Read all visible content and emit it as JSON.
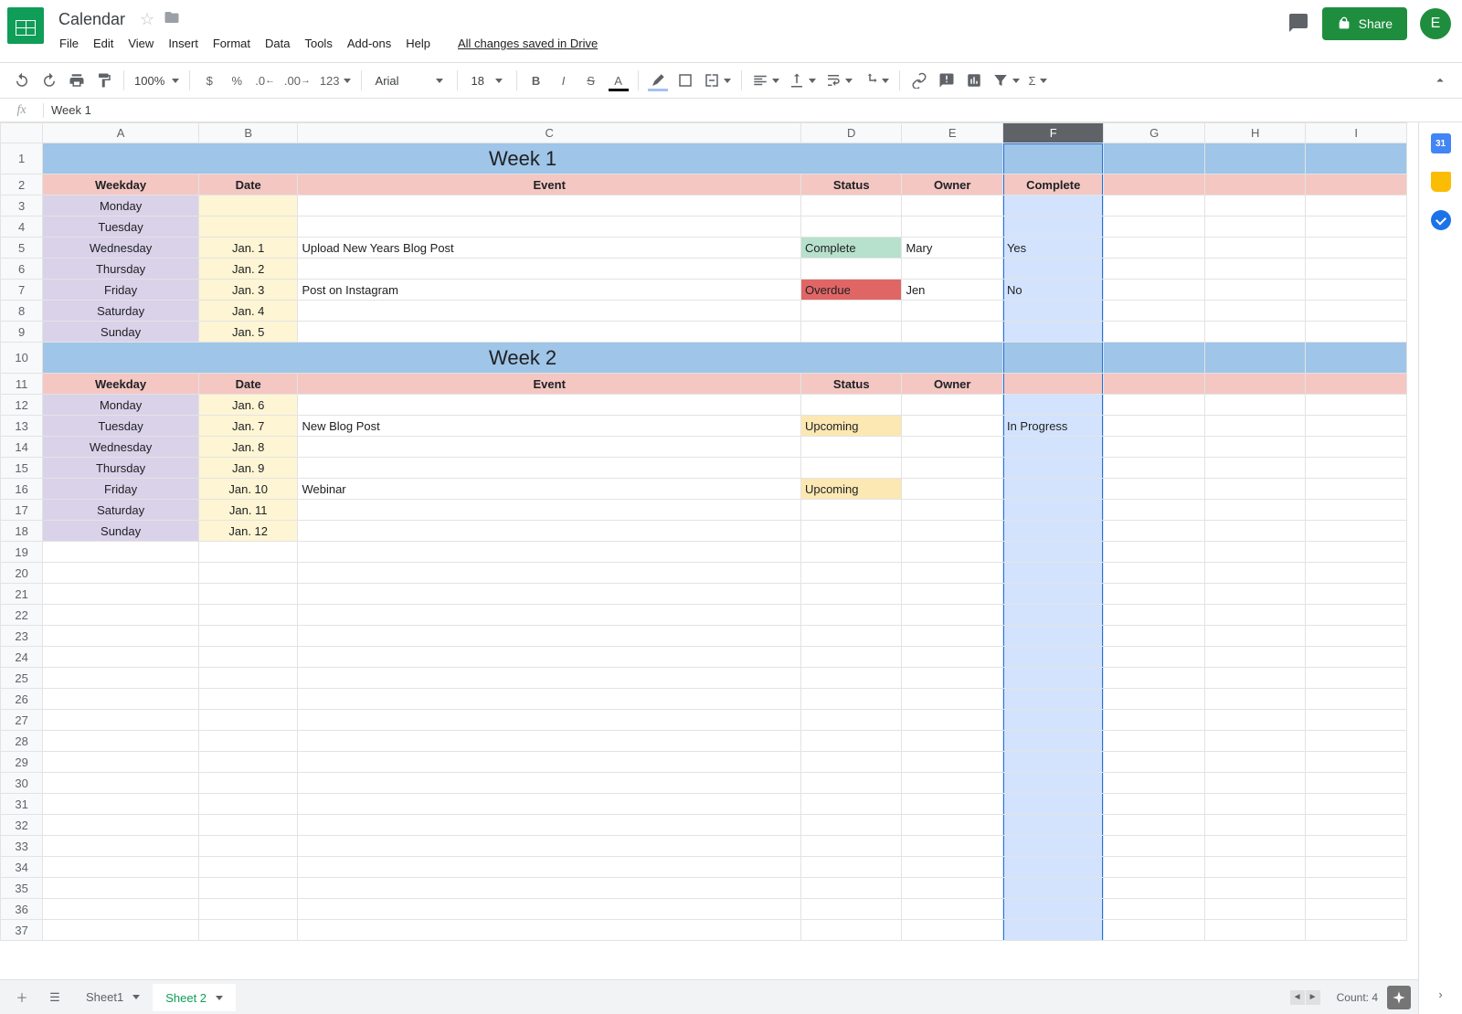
{
  "doc": {
    "title": "Calendar",
    "save_status": "All changes saved in Drive"
  },
  "menus": [
    "File",
    "Edit",
    "View",
    "Insert",
    "Format",
    "Data",
    "Tools",
    "Add-ons",
    "Help"
  ],
  "toolbar": {
    "zoom": "100%",
    "font": "Arial",
    "font_size": "18",
    "number_fmt": "123"
  },
  "share": {
    "label": "Share"
  },
  "avatar": {
    "initial": "E"
  },
  "formula_bar": {
    "label": "fx",
    "value": "Week 1"
  },
  "columns": [
    "A",
    "B",
    "C",
    "D",
    "E",
    "F",
    "G",
    "H",
    "I"
  ],
  "selected_column": "F",
  "weeks": [
    {
      "title": "Week 1",
      "headers": [
        "Weekday",
        "Date",
        "Event",
        "Status",
        "Owner",
        "Complete"
      ],
      "rows": [
        {
          "weekday": "Monday",
          "date": "",
          "event": "",
          "status": "",
          "status_class": "",
          "owner": "",
          "complete": ""
        },
        {
          "weekday": "Tuesday",
          "date": "",
          "event": "",
          "status": "",
          "status_class": "",
          "owner": "",
          "complete": ""
        },
        {
          "weekday": "Wednesday",
          "date": "Jan. 1",
          "event": "Upload New Years Blog Post",
          "status": "Complete",
          "status_class": "st-complete",
          "owner": "Mary",
          "complete": "Yes"
        },
        {
          "weekday": "Thursday",
          "date": "Jan. 2",
          "event": "",
          "status": "",
          "status_class": "",
          "owner": "",
          "complete": ""
        },
        {
          "weekday": "Friday",
          "date": "Jan. 3",
          "event": "Post on Instagram",
          "status": "Overdue",
          "status_class": "st-overdue",
          "owner": "Jen",
          "complete": "No"
        },
        {
          "weekday": "Saturday",
          "date": "Jan. 4",
          "event": "",
          "status": "",
          "status_class": "",
          "owner": "",
          "complete": ""
        },
        {
          "weekday": "Sunday",
          "date": "Jan. 5",
          "event": "",
          "status": "",
          "status_class": "",
          "owner": "",
          "complete": ""
        }
      ]
    },
    {
      "title": "Week 2",
      "headers": [
        "Weekday",
        "Date",
        "Event",
        "Status",
        "Owner",
        ""
      ],
      "rows": [
        {
          "weekday": "Monday",
          "date": "Jan. 6",
          "event": "",
          "status": "",
          "status_class": "",
          "owner": "",
          "complete": ""
        },
        {
          "weekday": "Tuesday",
          "date": "Jan. 7",
          "event": "New Blog Post",
          "status": "Upcoming",
          "status_class": "st-upcoming",
          "owner": "",
          "complete": "In Progress"
        },
        {
          "weekday": "Wednesday",
          "date": "Jan. 8",
          "event": "",
          "status": "",
          "status_class": "",
          "owner": "",
          "complete": ""
        },
        {
          "weekday": "Thursday",
          "date": "Jan. 9",
          "event": "",
          "status": "",
          "status_class": "",
          "owner": "",
          "complete": ""
        },
        {
          "weekday": "Friday",
          "date": "Jan. 10",
          "event": "Webinar",
          "status": "Upcoming",
          "status_class": "st-upcoming",
          "owner": "",
          "complete": ""
        },
        {
          "weekday": "Saturday",
          "date": "Jan. 11",
          "event": "",
          "status": "",
          "status_class": "",
          "owner": "",
          "complete": ""
        },
        {
          "weekday": "Sunday",
          "date": "Jan. 12",
          "event": "",
          "status": "",
          "status_class": "",
          "owner": "",
          "complete": ""
        }
      ]
    }
  ],
  "row_start": 1,
  "blank_rows_after": 19,
  "tabs": {
    "sheets": [
      "Sheet1",
      "Sheet 2"
    ],
    "active_index": 1,
    "count_label": "Count: 4"
  }
}
